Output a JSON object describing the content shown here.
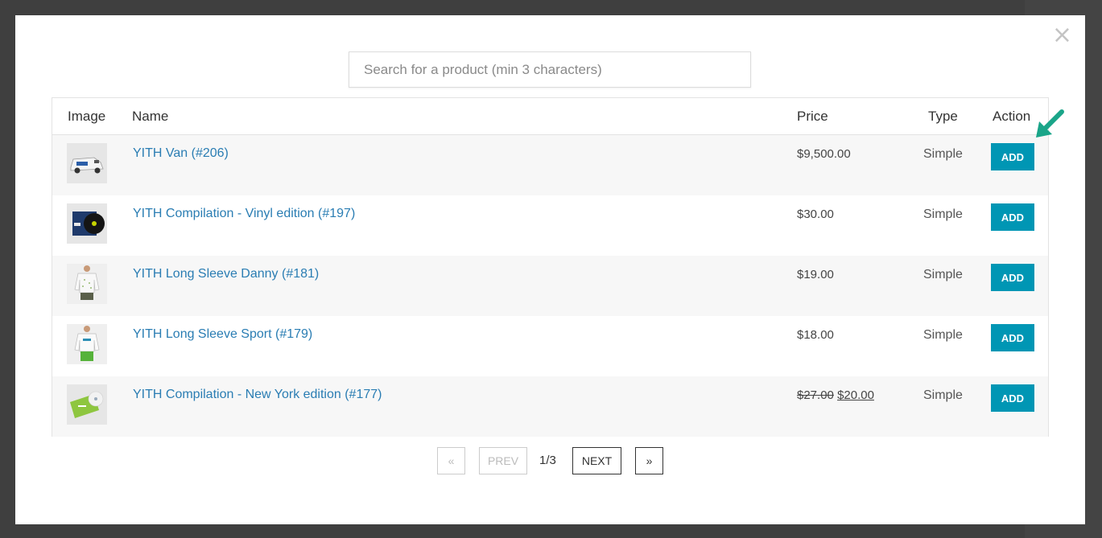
{
  "search": {
    "placeholder": "Search for a product (min 3 characters)"
  },
  "close_label": "×",
  "table": {
    "headers": {
      "image": "Image",
      "name": "Name",
      "price": "Price",
      "type": "Type",
      "action": "Action"
    },
    "rows": [
      {
        "name": "YITH Van (#206)",
        "price": "$9,500.00",
        "price_old": "",
        "price_new": "",
        "type": "Simple",
        "action": "ADD",
        "thumb": "van-image"
      },
      {
        "name": "YITH Compilation - Vinyl edition (#197)",
        "price": "$30.00",
        "price_old": "",
        "price_new": "",
        "type": "Simple",
        "action": "ADD",
        "thumb": "vinyl-image"
      },
      {
        "name": "YITH Long Sleeve Danny (#181)",
        "price": "$19.00",
        "price_old": "",
        "price_new": "",
        "type": "Simple",
        "action": "ADD",
        "thumb": "long-sleeve-danny-image"
      },
      {
        "name": "YITH Long Sleeve Sport (#179)",
        "price": "$18.00",
        "price_old": "",
        "price_new": "",
        "type": "Simple",
        "action": "ADD",
        "thumb": "long-sleeve-sport-image"
      },
      {
        "name": "YITH Compilation - New York edition (#177)",
        "price": "",
        "price_old": "$27.00",
        "price_new": "$20.00",
        "type": "Simple",
        "action": "ADD",
        "thumb": "compilation-ny-image"
      }
    ]
  },
  "pagination": {
    "first": "«",
    "prev": "PREV",
    "count": "1/3",
    "next": "NEXT",
    "last": "»"
  },
  "colors": {
    "accent": "#0096b4",
    "link": "#2a7db3",
    "arrow": "#1aa589"
  }
}
